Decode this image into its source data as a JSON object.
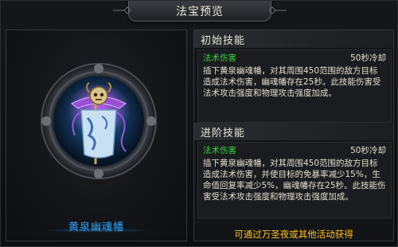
{
  "window": {
    "title": "法宝预览"
  },
  "relic": {
    "name": "黄泉幽魂幡"
  },
  "initial_skill": {
    "header": "初始技能",
    "type": "法术伤害",
    "cooldown": "50秒冷却",
    "description": "插下黄泉幽魂幡，对其周围450范围的敌方目标造成法术伤害，幽魂幡存在25秒。此技能伤害受法术攻击强度和物理攻击强度加成。"
  },
  "advanced_skill": {
    "header": "进阶技能",
    "type": "法术伤害",
    "cooldown": "50秒冷却",
    "description": "插下黄泉幽魂幡，对其周围450范围的敌方目标造成法术伤害，并使目标的免暴率减少15%，生命值回复率减少5%，幽魂幡存在25秒。此技能伤害受法术攻击强度和物理攻击强度加成。"
  },
  "acquire_text": "可通过万圣夜或其他活动获得",
  "colors": {
    "skill_type": "#39d43f",
    "relic_name": "#2fa6ff",
    "acquire": "#ffc21f"
  }
}
